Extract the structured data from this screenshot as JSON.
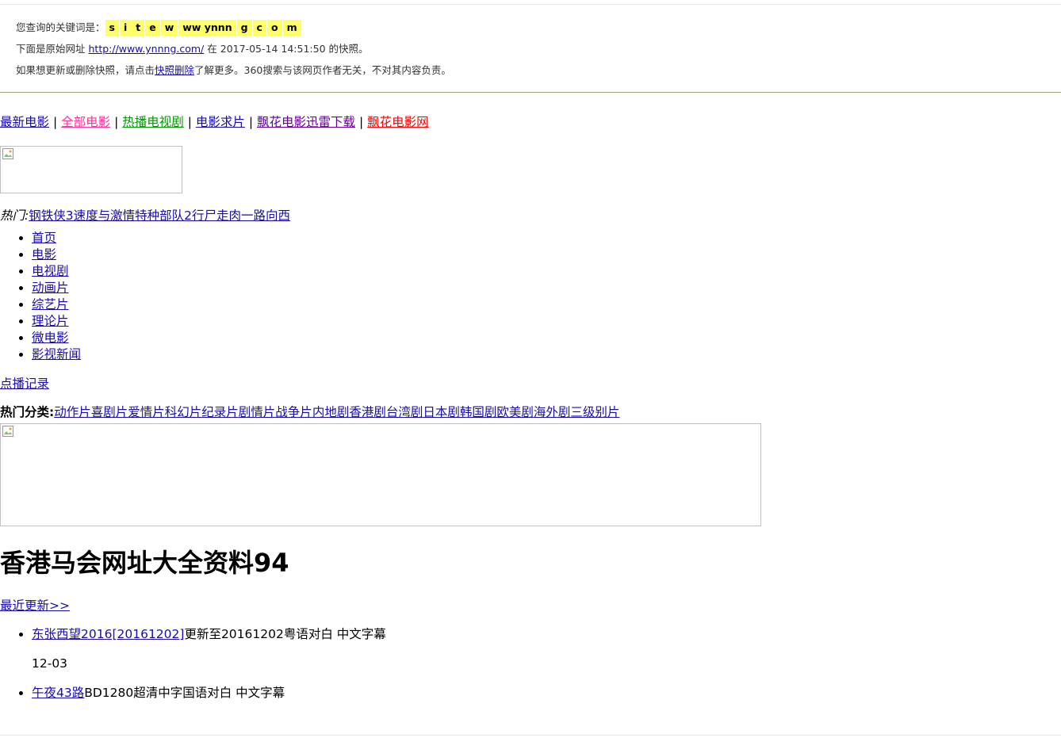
{
  "snapshot": {
    "keyword_label": "您查询的关键词是：",
    "keywords": [
      "s",
      "i",
      "t",
      "e",
      "w",
      "ww ynnn",
      "g",
      "c",
      "o",
      "m"
    ],
    "line2_prefix": "下面是原始网址",
    "original_url": "http://www.ynnng.com/",
    "line2_mid": "在",
    "timestamp": "2017-05-14 14:51:50",
    "line2_suffix": "的快照。",
    "line3_prefix": "如果想更新或删除快照，请点击",
    "delete_link": "快照删除",
    "line3_suffix": "了解更多。360搜索与该网页作者无关，不对其内容负责。",
    "kw_colors": [
      "#ffff66",
      "#a0ffff",
      "#99ff99",
      "#ff9999",
      "#ff66ff",
      "#880000",
      "#00aa00",
      "#886800"
    ]
  },
  "nav": {
    "separator": "|",
    "links": [
      {
        "label": "最新电影",
        "color": "#1a0dab"
      },
      {
        "label": "全部电影",
        "color": "#ff3399"
      },
      {
        "label": "热播电视剧",
        "color": "#009900"
      },
      {
        "label": "电影求片",
        "color": "#1a0dab"
      },
      {
        "label": "飘花电影迅雷下载",
        "color": "#660099"
      },
      {
        "label": "飘花电影网",
        "color": "#ff0000"
      }
    ]
  },
  "hot": {
    "label": "热门:",
    "links": [
      "钢铁侠3",
      "速度与激情",
      "特种部队2",
      "行尸走肉",
      "一路向西"
    ]
  },
  "menu": [
    "首页",
    "电影",
    "电视剧",
    "动画片",
    "综艺片",
    "理论片",
    "微电影",
    "影视新闻"
  ],
  "record_link": "点播记录",
  "categories": {
    "label": "热门分类:",
    "links": [
      "动作片",
      "喜剧片",
      "爱情片",
      "科幻片",
      "纪录片",
      "剧情片",
      "战争片",
      "内地剧",
      "香港剧",
      "台湾剧",
      "日本剧",
      "韩国剧",
      "欧美剧",
      "海外剧",
      "三级别片"
    ]
  },
  "page_title": "香港马会网址大全资料94",
  "recent_link": "最近更新>>",
  "updates": [
    {
      "title": "东张西望2016[20161202]",
      "desc": "更新至20161202粤语对白 中文字幕",
      "date": "12-03"
    },
    {
      "title": "午夜43路",
      "desc": "BD1280超清中字国语对白 中文字幕",
      "date": ""
    }
  ]
}
